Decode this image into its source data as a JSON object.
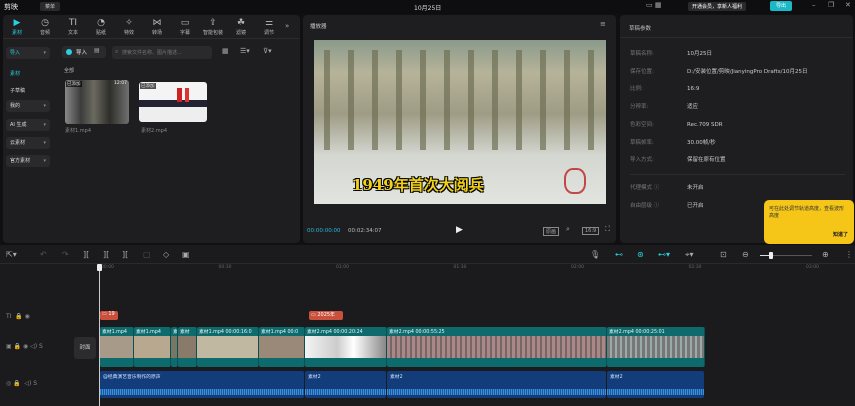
{
  "app": {
    "logo": "剪映",
    "menu": "菜单",
    "title": "10月25日",
    "vip": "开通会员，享新人福利",
    "export": "导出"
  },
  "tabs": [
    {
      "icon": "▶",
      "label": "素材"
    },
    {
      "icon": "◷",
      "label": "音频"
    },
    {
      "icon": "TI",
      "label": "文本"
    },
    {
      "icon": "◔",
      "label": "贴纸"
    },
    {
      "icon": "✧",
      "label": "特效"
    },
    {
      "icon": "⋈",
      "label": "转场"
    },
    {
      "icon": "▭",
      "label": "字幕"
    },
    {
      "icon": "⇪",
      "label": "智能包装"
    },
    {
      "icon": "☘",
      "label": "滤镜"
    },
    {
      "icon": "⚌",
      "label": "调节"
    }
  ],
  "sidebar": [
    {
      "label": "导入"
    },
    {
      "label": "素材"
    },
    {
      "label": "子草稿"
    },
    {
      "label": "我的"
    },
    {
      "label": "AI 生成"
    },
    {
      "label": "云素材"
    },
    {
      "label": "官方素材"
    }
  ],
  "media": {
    "import": "导入",
    "search_placeholder": "搜索文件名称、图片描述...",
    "section": "全部",
    "items": [
      {
        "name": "素材1.mp4",
        "badge": "已添加",
        "duration": "12:07"
      },
      {
        "name": "素材2.mp4",
        "badge": "已添加",
        "duration": ""
      }
    ]
  },
  "player": {
    "title": "播放器",
    "caption": "1949年首次大阅兵",
    "current": "00:00:00:00",
    "total": "00:02:34:07",
    "ratio": "16:9"
  },
  "draft": {
    "title": "草稿参数",
    "rows": [
      {
        "k": "草稿名称:",
        "v": "10月25日"
      },
      {
        "k": "保存位置:",
        "v": "D:/安装位置/剪映/JianyingPro Drafts/10月25日"
      },
      {
        "k": "比例:",
        "v": "16:9"
      },
      {
        "k": "分辨率:",
        "v": "适应"
      },
      {
        "k": "色彩空间:",
        "v": "Rec.709 SDR"
      },
      {
        "k": "草稿帧率:",
        "v": "30.00帧/秒"
      },
      {
        "k": "导入方式:",
        "v": "保留在原有位置"
      },
      {
        "k": "代理模式 ⓘ",
        "v": "未开启"
      },
      {
        "k": "自由层级 ⓘ",
        "v": "已开启"
      }
    ]
  },
  "tooltip": {
    "text": "可在此处调节轨道高度，查看波形高度",
    "ok": "知道了"
  },
  "timeline": {
    "ticks": [
      "00:00",
      "00:30",
      "01:00",
      "01:30",
      "02:00",
      "02:30",
      "03:00"
    ],
    "cover": "封面",
    "text_clips": [
      "19",
      "2025年"
    ],
    "video_clips": [
      "素材1.mp4",
      "素材1.mp4",
      "素",
      "素材",
      "素材1.mp4 00:00:16:0",
      "素材1.mp4 00:0",
      "素材2.mp4 00:00:20:24",
      "素材2.mp4 00:00:55:25",
      "素材2.mp4 00:00:25:01"
    ],
    "audio_clips": [
      "@经典演艺音乐制作的原声",
      "素材2",
      "素材2",
      "素材2"
    ]
  }
}
